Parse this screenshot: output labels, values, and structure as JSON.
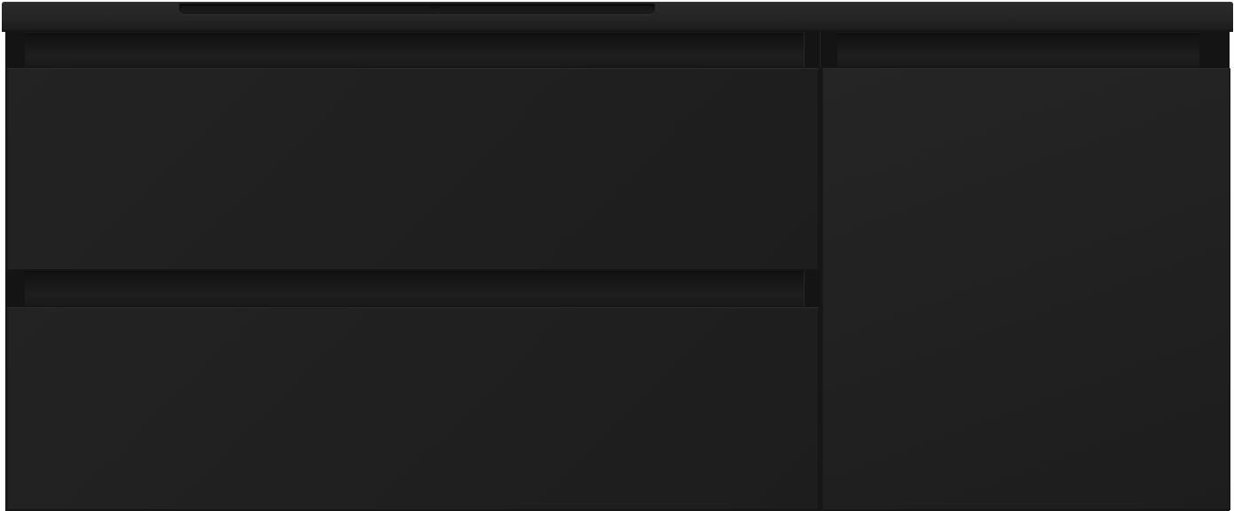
{
  "image": {
    "subject": "vanity-unit",
    "colors": {
      "body": "#202020",
      "countertop": "#242424",
      "shadow": "#141414"
    }
  }
}
